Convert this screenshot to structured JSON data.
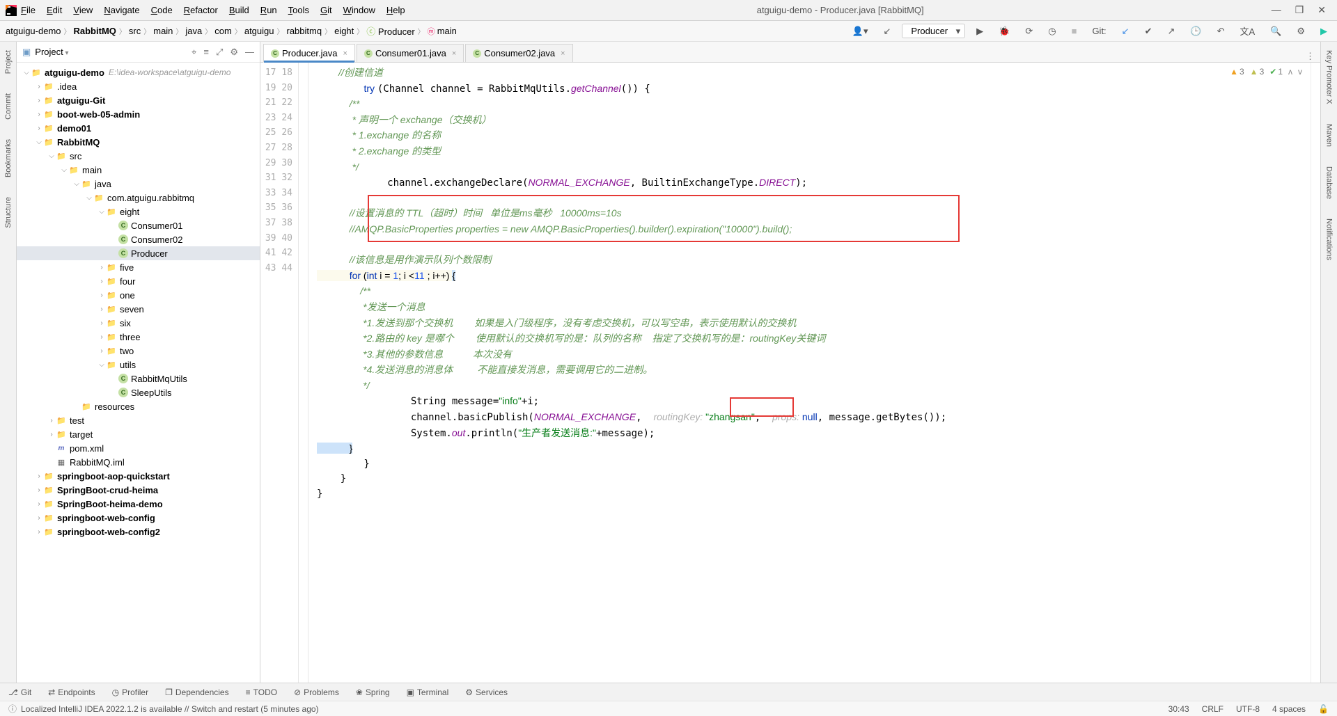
{
  "title": "atguigu-demo - Producer.java [RabbitMQ]",
  "menu": [
    "File",
    "Edit",
    "View",
    "Navigate",
    "Code",
    "Refactor",
    "Build",
    "Run",
    "Tools",
    "Git",
    "Window",
    "Help"
  ],
  "breadcrumb": [
    "atguigu-demo",
    "RabbitMQ",
    "src",
    "main",
    "java",
    "com",
    "atguigu",
    "rabbitmq",
    "eight",
    "Producer",
    "main"
  ],
  "runConfig": "Producer",
  "gitLabel": "Git:",
  "leftTabs": [
    "Project",
    "Commit",
    "Bookmarks",
    "Structure"
  ],
  "rightTabs": [
    "Key Promoter X",
    "Maven",
    "Database",
    "Notifications"
  ],
  "projectTool": {
    "title": "Project",
    "icons": [
      "target",
      "select",
      "sort",
      "settings",
      "hide",
      "collapse"
    ]
  },
  "tree": [
    {
      "d": 0,
      "exp": "v",
      "ico": "dir",
      "label": "atguigu-demo",
      "bold": true,
      "hint": "E:\\idea-workspace\\atguigu-demo"
    },
    {
      "d": 1,
      "exp": ">",
      "ico": "orangedir",
      "label": ".idea"
    },
    {
      "d": 1,
      "exp": ">",
      "ico": "bluedir",
      "label": "atguigu-Git",
      "bold": true
    },
    {
      "d": 1,
      "exp": ">",
      "ico": "bluedir",
      "label": "boot-web-05-admin",
      "bold": true
    },
    {
      "d": 1,
      "exp": ">",
      "ico": "bluedir",
      "label": "demo01",
      "bold": true
    },
    {
      "d": 1,
      "exp": "v",
      "ico": "bluedir",
      "label": "RabbitMQ",
      "bold": true
    },
    {
      "d": 2,
      "exp": "v",
      "ico": "bluedir",
      "label": "src"
    },
    {
      "d": 3,
      "exp": "v",
      "ico": "bluedir",
      "label": "main"
    },
    {
      "d": 4,
      "exp": "v",
      "ico": "bluedir",
      "label": "java"
    },
    {
      "d": 5,
      "exp": "v",
      "ico": "dir",
      "label": "com.atguigu.rabbitmq"
    },
    {
      "d": 6,
      "exp": "v",
      "ico": "dir",
      "label": "eight"
    },
    {
      "d": 7,
      "exp": "",
      "ico": "cls",
      "label": "Consumer01"
    },
    {
      "d": 7,
      "exp": "",
      "ico": "cls",
      "label": "Consumer02"
    },
    {
      "d": 7,
      "exp": "",
      "ico": "cls",
      "label": "Producer",
      "sel": true
    },
    {
      "d": 6,
      "exp": ">",
      "ico": "dir",
      "label": "five"
    },
    {
      "d": 6,
      "exp": ">",
      "ico": "dir",
      "label": "four"
    },
    {
      "d": 6,
      "exp": ">",
      "ico": "dir",
      "label": "one"
    },
    {
      "d": 6,
      "exp": ">",
      "ico": "dir",
      "label": "seven"
    },
    {
      "d": 6,
      "exp": ">",
      "ico": "dir",
      "label": "six"
    },
    {
      "d": 6,
      "exp": ">",
      "ico": "dir",
      "label": "three"
    },
    {
      "d": 6,
      "exp": ">",
      "ico": "dir",
      "label": "two"
    },
    {
      "d": 6,
      "exp": "v",
      "ico": "dir",
      "label": "utils"
    },
    {
      "d": 7,
      "exp": "",
      "ico": "cls",
      "label": "RabbitMqUtils"
    },
    {
      "d": 7,
      "exp": "",
      "ico": "cls",
      "label": "SleepUtils"
    },
    {
      "d": 4,
      "exp": "",
      "ico": "dir",
      "label": "resources"
    },
    {
      "d": 2,
      "exp": ">",
      "ico": "dir",
      "label": "test"
    },
    {
      "d": 2,
      "exp": ">",
      "ico": "orangedir",
      "label": "target"
    },
    {
      "d": 2,
      "exp": "",
      "ico": "xml",
      "label": "pom.xml"
    },
    {
      "d": 2,
      "exp": "",
      "ico": "iml",
      "label": "RabbitMQ.iml"
    },
    {
      "d": 1,
      "exp": ">",
      "ico": "bluedir",
      "label": "springboot-aop-quickstart",
      "bold": true
    },
    {
      "d": 1,
      "exp": ">",
      "ico": "bluedir",
      "label": "SpringBoot-crud-heima",
      "bold": true
    },
    {
      "d": 1,
      "exp": ">",
      "ico": "bluedir",
      "label": "SpringBoot-heima-demo",
      "bold": true
    },
    {
      "d": 1,
      "exp": ">",
      "ico": "bluedir",
      "label": "springboot-web-config",
      "bold": true
    },
    {
      "d": 1,
      "exp": ">",
      "ico": "bluedir",
      "label": "springboot-web-config2",
      "bold": true
    }
  ],
  "editorTabs": [
    {
      "label": "Producer.java",
      "active": true
    },
    {
      "label": "Consumer01.java",
      "active": false
    },
    {
      "label": "Consumer02.java",
      "active": false
    }
  ],
  "lineStart": 17,
  "lineEnd": 44,
  "inspections": {
    "warn": "3",
    "weak": "3",
    "ok": "1"
  },
  "code": {
    "l17": "        //创建信道",
    "l18a": "        ",
    "l18b": "try ",
    "l18c": "(Channel channel = RabbitMqUtils.",
    "l18d": "getChannel",
    "l18e": "()) {",
    "l19": "            /**",
    "l20": "             * 声明一个 exchange（交换机）",
    "l21": "             * 1.exchange 的名称",
    "l22": "             * 2.exchange 的类型",
    "l23": "             */",
    "l24a": "            channel.exchangeDeclare(",
    "l24b": "NORMAL_EXCHANGE",
    "l24c": ", BuiltinExchangeType.",
    "l24d": "DIRECT",
    "l24e": ");",
    "l26": "            //设置消息的 TTL（超时）时间   单位是ms毫秒   10000ms=10s",
    "l27": "            //AMQP.BasicProperties properties = new AMQP.BasicProperties().builder().expiration(\"10000\").build();",
    "l29": "            //该信息是用作演示队列个数限制",
    "l30a": "            ",
    "l30b": "for ",
    "l30c": "(",
    "l30d": "int ",
    "l30e": "i = ",
    "l30f": "1",
    "l30g": "; i <",
    "l30h": "11 ",
    "l30i": "; i++) ",
    "l30j": "{",
    "l31": "                /**",
    "l32": "                 *发送一个消息",
    "l33": "                 *1.发送到那个交换机        如果是入门级程序，没有考虑交换机，可以写空串，表示使用默认的交换机",
    "l34": "                 *2.路由的 key 是哪个        使用默认的交换机写的是：队列的名称    指定了交换机写的是：routingKey关键词",
    "l35": "                 *3.其他的参数信息           本次没有",
    "l36": "                 *4.发送消息的消息体         不能直接发消息，需要调用它的二进制。",
    "l37": "                 */",
    "l38a": "                String message=",
    "l38b": "\"info\"",
    "l38c": "+i;",
    "l39a": "                channel.basicPublish(",
    "l39b": "NORMAL_EXCHANGE",
    "l39c": ",  ",
    "l39d": "routingKey: ",
    "l39e": "\"zhangsan\"",
    "l39f": ",  ",
    "l39g": "props: ",
    "l39h": "null",
    "l39i": ", message.getBytes());",
    "l40a": "                System.",
    "l40b": "out",
    "l40c": ".println(",
    "l40d": "\"生产者发送消息:\"",
    "l40e": "+message);",
    "l41": "            }",
    "l42": "        }",
    "l43": "    }",
    "l44": "}"
  },
  "bottomTools": [
    "Git",
    "Endpoints",
    "Profiler",
    "Dependencies",
    "TODO",
    "Problems",
    "Spring",
    "Terminal",
    "Services"
  ],
  "status": {
    "msg": "Localized IntelliJ IDEA 2022.1.2 is available // Switch and restart (5 minutes ago)",
    "pos": "30:43",
    "sep": "CRLF",
    "enc": "UTF-8",
    "indent": "4 spaces"
  }
}
